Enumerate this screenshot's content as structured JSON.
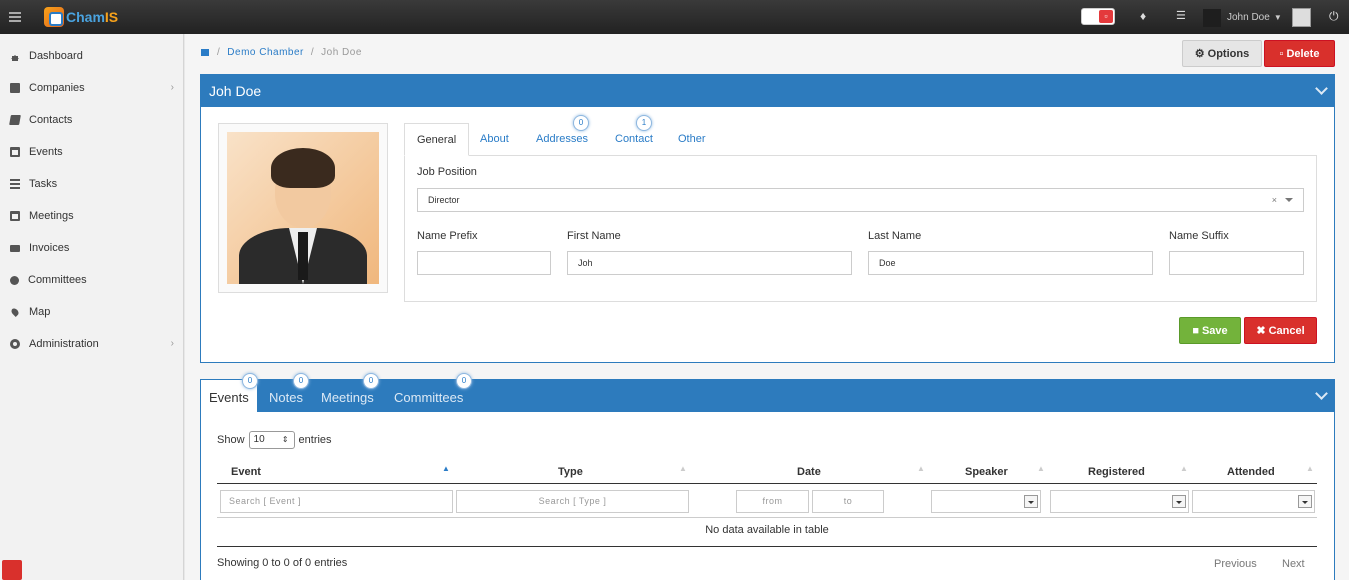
{
  "topbar": {
    "logo_text_a": "Cham",
    "logo_text_b": "IS",
    "user_name": "John Doe",
    "icons": [
      "menu-icon",
      "trash-icon",
      "bell-icon",
      "server-icon",
      "power-icon"
    ]
  },
  "sidebar": {
    "items": [
      {
        "label": "Dashboard",
        "icon": "home-icon",
        "has_submenu": false
      },
      {
        "label": "Companies",
        "icon": "building-icon",
        "has_submenu": true
      },
      {
        "label": "Contacts",
        "icon": "book-icon",
        "has_submenu": false
      },
      {
        "label": "Events",
        "icon": "calendar-icon",
        "has_submenu": false
      },
      {
        "label": "Tasks",
        "icon": "tasks-icon",
        "has_submenu": false
      },
      {
        "label": "Meetings",
        "icon": "calendar-grid-icon",
        "has_submenu": false
      },
      {
        "label": "Invoices",
        "icon": "money-icon",
        "has_submenu": false
      },
      {
        "label": "Committees",
        "icon": "users-icon",
        "has_submenu": false
      },
      {
        "label": "Map",
        "icon": "map-marker-icon",
        "has_submenu": false
      },
      {
        "label": "Administration",
        "icon": "cogs-icon",
        "has_submenu": true
      }
    ]
  },
  "breadcrumb": {
    "items": [
      "Demo Chamber",
      "Joh Doe"
    ],
    "separator": "/"
  },
  "header_actions": {
    "options_label": "Options",
    "delete_label": "Delete"
  },
  "contact_panel": {
    "title": "Joh Doe",
    "tabs": [
      {
        "label": "General",
        "badge": null
      },
      {
        "label": "About",
        "badge": null
      },
      {
        "label": "Addresses",
        "badge": "0"
      },
      {
        "label": "Contact",
        "badge": "1"
      },
      {
        "label": "Other",
        "badge": null
      }
    ],
    "job_position_label": "Job Position",
    "job_position_value": "Director",
    "job_position_clear": "×",
    "name_prefix_label": "Name Prefix",
    "name_prefix_value": "",
    "first_name_label": "First Name",
    "first_name_value": "Joh",
    "last_name_label": "Last Name",
    "last_name_value": "Doe",
    "name_suffix_label": "Name Suffix",
    "name_suffix_value": "",
    "save_label": "Save",
    "cancel_label": "Cancel"
  },
  "related_panel": {
    "tabs": [
      {
        "label": "Events",
        "badge": "0"
      },
      {
        "label": "Notes",
        "badge": "0"
      },
      {
        "label": "Meetings",
        "badge": "0"
      },
      {
        "label": "Committees",
        "badge": "0"
      }
    ],
    "show_label": "Show",
    "entries_value": "10",
    "entries_label": "entries",
    "columns": [
      "Event",
      "Type",
      "Date",
      "Speaker",
      "Registered",
      "Attended"
    ],
    "search_event_placeholder": "Search [ Event ]",
    "search_type_placeholder": "Search [ Type ]",
    "date_from_placeholder": "from",
    "date_to_placeholder": "to",
    "empty_text": "No data available in table",
    "info_text": "Showing 0 to 0 of 0 entries",
    "previous_label": "Previous",
    "next_label": "Next"
  }
}
